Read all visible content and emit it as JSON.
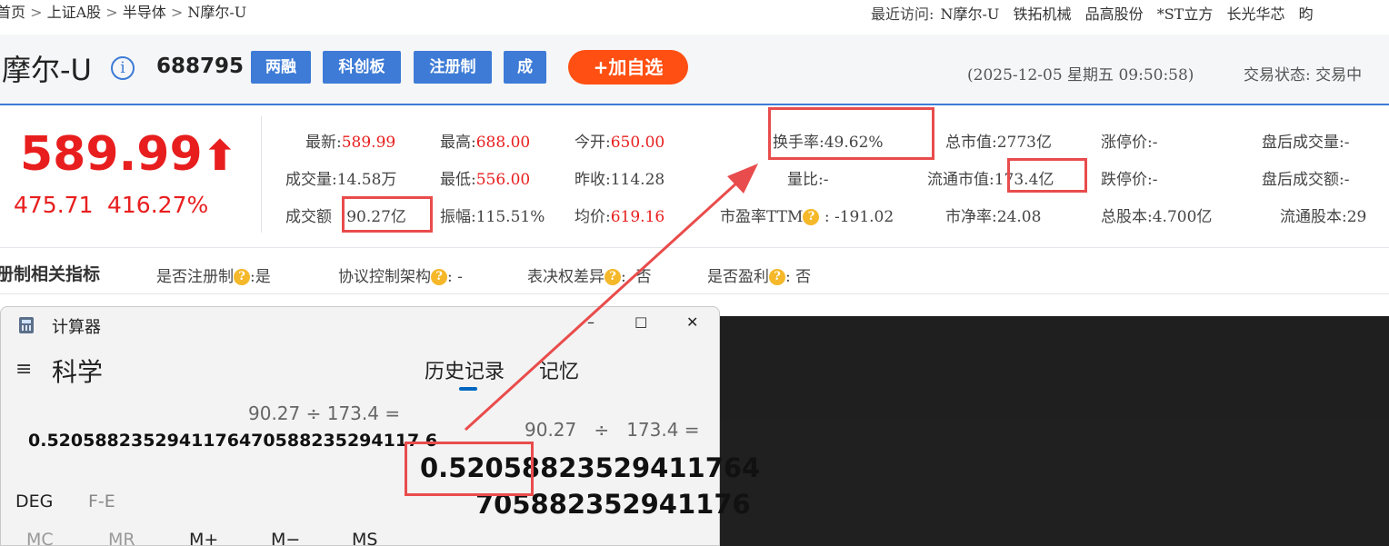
{
  "nav": {
    "breadcrumb": [
      "首页",
      "上证A股",
      "半导体",
      "N摩尔-U"
    ],
    "recent_label": "最近访问:",
    "recent_items": [
      "N摩尔-U",
      "铁拓机械",
      "品高股份",
      "*ST立方",
      "长光华芯",
      "昀"
    ]
  },
  "stock": {
    "name": "摩尔-U",
    "code": "688795",
    "tags": [
      "两融",
      "科创板",
      "注册制",
      "成"
    ],
    "add_button": "+加自选",
    "datetime": "(2025-12-05 星期五 09:50:58)",
    "trade_status": "交易状态: 交易中",
    "price": "589.99",
    "change": "475.71",
    "change_pct": "416.27%"
  },
  "quote": {
    "rows": [
      [
        {
          "label": "最新:",
          "value": "589.99",
          "color": "red"
        },
        {
          "label": "最高:",
          "value": "688.00",
          "color": "red"
        },
        {
          "label": "今开:",
          "value": "650.00",
          "color": "red"
        },
        {
          "label": "换手率:",
          "value": "49.62%",
          "color": "gray"
        },
        {
          "label": "总市值:",
          "value": "2773亿",
          "color": "gray"
        },
        {
          "label": "涨停价:",
          "value": "-",
          "color": "gray"
        },
        {
          "label": "盘后成交量:",
          "value": "-",
          "color": "gray"
        }
      ],
      [
        {
          "label": "成交量:",
          "value": "14.58万",
          "color": "gray"
        },
        {
          "label": "最低:",
          "value": "556.00",
          "color": "red"
        },
        {
          "label": "昨收:",
          "value": "114.28",
          "color": "gray"
        },
        {
          "label": "量比:",
          "value": "-",
          "color": "gray"
        },
        {
          "label": "流通市值:",
          "value": "173.4亿",
          "color": "gray"
        },
        {
          "label": "跌停价:",
          "value": "-",
          "color": "gray"
        },
        {
          "label": "盘后成交额:",
          "value": "-",
          "color": "gray"
        }
      ],
      [
        {
          "label": "成交额",
          "value": "90.27亿",
          "color": "gray"
        },
        {
          "label": "振幅:",
          "value": "115.51%",
          "color": "gray"
        },
        {
          "label": "均价:",
          "value": "619.16",
          "color": "red"
        },
        {
          "label": "市盈率TTM",
          "value": ": -191.02",
          "color": "gray"
        },
        {
          "label": "市净率:",
          "value": "24.08",
          "color": "gray"
        },
        {
          "label": "总股本:",
          "value": "4.700亿",
          "color": "gray"
        },
        {
          "label": "流通股本:",
          "value": "29",
          "color": "gray"
        }
      ]
    ],
    "q_mark": "?"
  },
  "registration": {
    "title": "册制相关指标",
    "items": [
      {
        "label": "是否注册制",
        "value": "是"
      },
      {
        "label": "协议控制架构",
        "value": "-"
      },
      {
        "label": "表决权差异",
        "value": "否"
      },
      {
        "label": "是否盈利",
        "value": "否"
      }
    ]
  },
  "calculator": {
    "title": "计算器",
    "mode": "科学",
    "tabs": [
      "历史记录",
      "记忆"
    ],
    "expression": "90.27 ÷ 173.4 =",
    "result": "0.5205882352941176470588235294117 6",
    "history_expr_a": "90.27",
    "history_expr_op": "÷",
    "history_expr_b": "173.4 =",
    "history_result_line1": "0.520588235294117 64",
    "history_result_line2": "705882352941176",
    "deg": "DEG",
    "fe": "F-E",
    "mem_buttons": [
      "MC",
      "MR",
      "M+",
      "M−",
      "MS"
    ],
    "controls": {
      "minimize": "–",
      "maximize": "□",
      "close": "✕"
    }
  },
  "colors": {
    "accent": "#3d7bd6",
    "up": "#e81e1e",
    "add_button": "#ff4f12",
    "annotation": "#e94c4c"
  }
}
